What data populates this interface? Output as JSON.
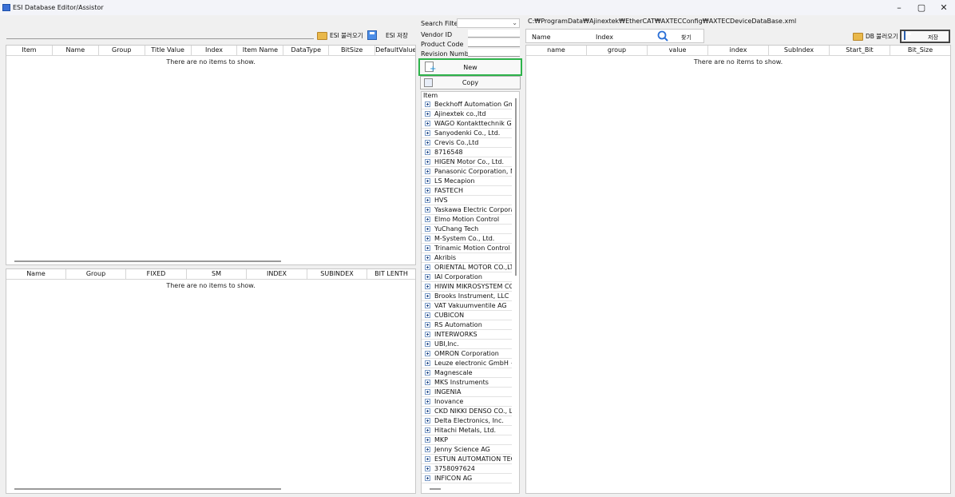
{
  "window": {
    "title": "ESI Database Editor/Assistor",
    "minimize": "–",
    "restore": "▢",
    "close": "✕"
  },
  "left_toolbar": {
    "open_label": "ESI 불러오기",
    "save_label": "ESI 저장"
  },
  "top_table": {
    "columns": [
      "Item",
      "Name",
      "Group",
      "Title Value",
      "Index",
      "Item Name",
      "DataType",
      "BitSize",
      "DefaultValue"
    ],
    "empty_text": "There are no items to show."
  },
  "bottom_table": {
    "columns": [
      "Name",
      "Group",
      "FIXED",
      "SM",
      "INDEX",
      "SUBINDEX",
      "BIT LENTH"
    ],
    "empty_text": "There are no items to show."
  },
  "middle": {
    "search_filter_label": "Search Filter",
    "vendor_id_label": "Vendor ID",
    "product_code_label": "Product Code",
    "revision_number_label": "Revision Number",
    "new_label": "New",
    "copy_label": "Copy",
    "tree_header": "Item",
    "tree_items": [
      "Beckhoff Automation GmbH",
      "Ajinextek co.,ltd",
      "WAGO Kontakttechnik GmbH",
      "Sanyodenki Co., Ltd.",
      "Crevis Co.,Ltd",
      "8716548",
      "HIGEN Motor Co., Ltd.",
      "Panasonic Corporation, Moto",
      "LS Mecapion",
      "FASTECH",
      "HVS",
      "Yaskawa Electric Corporation",
      "Elmo Motion Control",
      "YuChang Tech",
      "M-System Co., Ltd.",
      "Trinamic Motion Control Gm",
      "Akribis",
      "ORIENTAL MOTOR CO.,LTD.",
      "IAI Corporation",
      "HIWIN MIKROSYSTEM CORP.",
      "Brooks Instrument, LLC",
      "VAT Vakuumventile AG",
      "CUBICON",
      "RS Automation",
      "INTERWORKS",
      "UBI,Inc.",
      "OMRON Corporation",
      "Leuze electronic GmbH + Co",
      "Magnescale",
      "MKS Instruments",
      "INGENIA",
      "Inovance",
      "CKD NIKKI DENSO CO., LTD.",
      "Delta Electronics, Inc.",
      "Hitachi Metals, Ltd.",
      "MKP",
      "Jenny Science AG",
      "ESTUN AUTOMATION TECHN",
      "3758097624",
      "INFICON AG"
    ]
  },
  "right": {
    "path": "C:₩ProgramData₩Ajinextek₩EtherCAT₩AXTECConfig₩AXTECDeviceDataBase.xml",
    "name_label": "Name",
    "index_label": "Index",
    "find_label": "찾기",
    "db_open_label": "DB 불러오기",
    "save_label": "저장",
    "columns": [
      "name",
      "group",
      "value",
      "index",
      "SubIndex",
      "Start_Bit",
      "Bit_Size"
    ],
    "empty_text": "There are no items to show."
  },
  "colors": {
    "accent_green": "#2db34a",
    "icon_blue": "#4c8ee8"
  }
}
